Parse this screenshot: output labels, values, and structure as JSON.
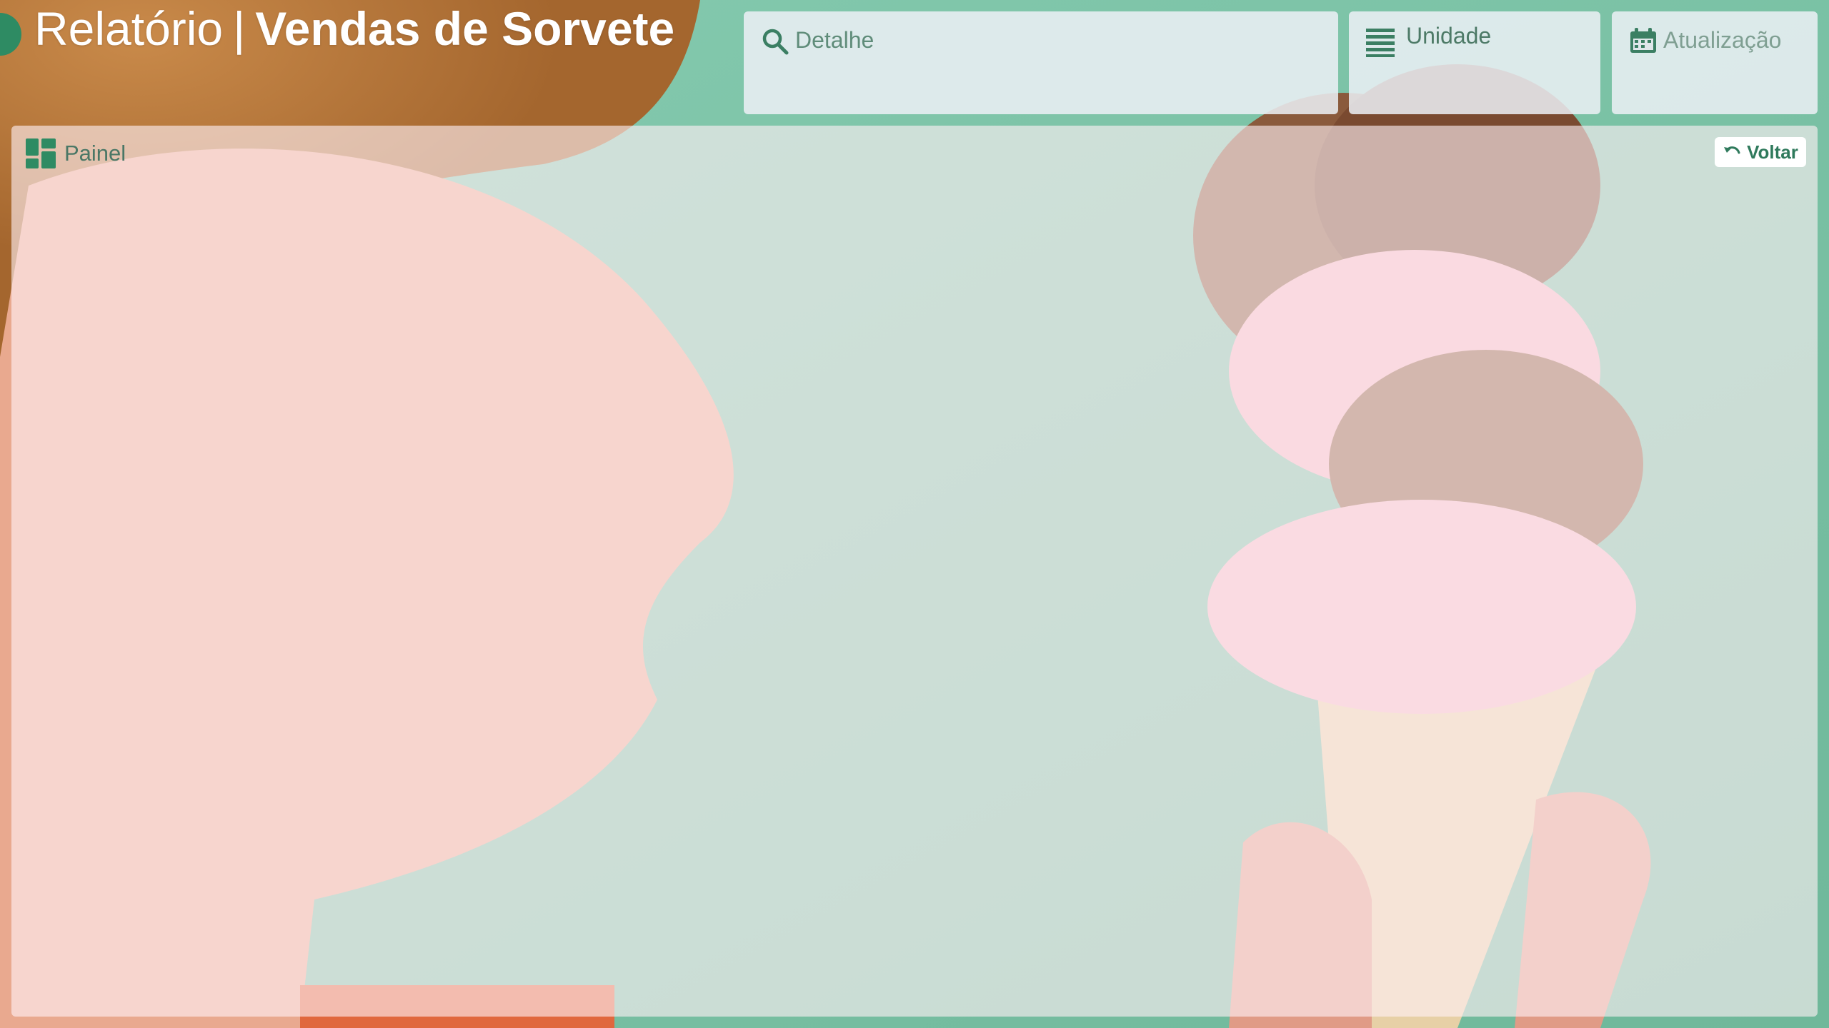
{
  "header": {
    "title_light": "Relatório",
    "title_separator": "|",
    "title_bold": "Vendas de Sorvete"
  },
  "filters": {
    "detail": {
      "label": "Detalhe",
      "icon": "search-icon"
    },
    "unit": {
      "label": "Unidade",
      "icon": "list-lines-icon"
    },
    "update": {
      "label": "Atualização",
      "icon": "calendar-icon"
    }
  },
  "panel": {
    "title": "Painel",
    "icon": "dashboard-grid-icon",
    "back_button": {
      "label": "Voltar",
      "icon": "undo-arrow-icon"
    }
  },
  "colors": {
    "accent_green": "#2e8b63",
    "background_mint": "#7fc3a6",
    "title_white": "#ffffff"
  }
}
